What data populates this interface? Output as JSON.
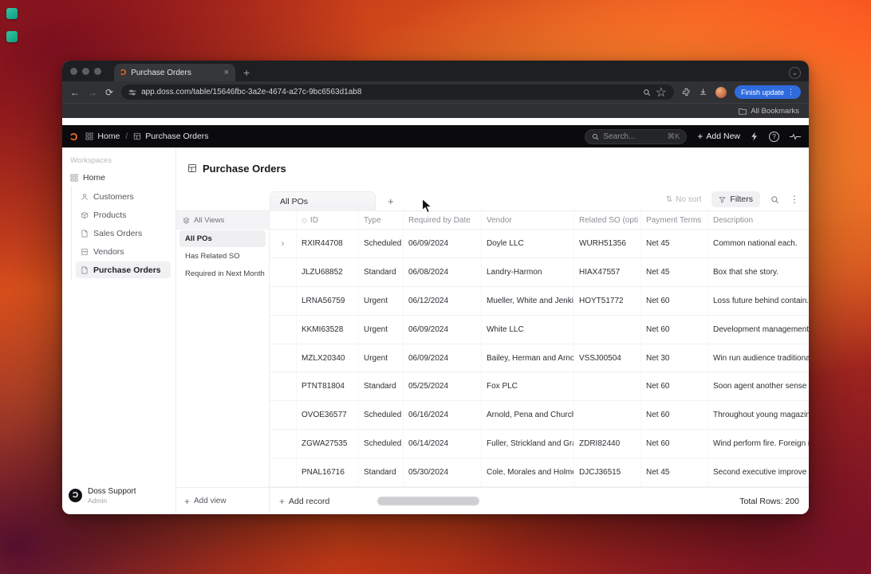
{
  "colors": {
    "accent_blue": "#2f6bdf",
    "logo_orange": "#ff6a1f",
    "header_black": "#0b0b0d"
  },
  "browser": {
    "tab_title": "Purchase Orders",
    "url": "app.doss.com/table/15646fbc-3a2e-4674-a27c-9bc6563d1ab8",
    "update_button": "Finish update",
    "bookmarks_label": "All Bookmarks"
  },
  "app": {
    "header": {
      "breadcrumb_home": "Home",
      "breadcrumb_separator": "/",
      "breadcrumb_current": "Purchase Orders",
      "search_placeholder": "Search...",
      "search_shortcut": "⌘K",
      "add_new_label": "Add New"
    },
    "sidebar": {
      "workspaces_label": "Workspaces",
      "home_label": "Home",
      "items": [
        {
          "label": "Customers"
        },
        {
          "label": "Products"
        },
        {
          "label": "Sales Orders"
        },
        {
          "label": "Vendors"
        },
        {
          "label": "Purchase Orders"
        }
      ],
      "selected_item": "Purchase Orders",
      "user_name": "Doss Support",
      "user_role": "Admin"
    },
    "main": {
      "page_title": "Purchase Orders",
      "view_tab": "All POs",
      "toolbar": {
        "no_sort_label": "No sort",
        "filters_label": "Filters"
      },
      "views_panel": {
        "header": "All Views",
        "items": [
          "All POs",
          "Has Related SO",
          "Required in Next Month"
        ],
        "selected": "All POs",
        "add_view_label": "Add view"
      },
      "table": {
        "columns": {
          "id": "ID",
          "type": "Type",
          "date": "Required by Date",
          "vendor": "Vendor",
          "related_so": "Related SO (opti",
          "payment_terms": "Payment Terms",
          "description": "Description"
        },
        "rows": [
          {
            "id": "RXIR44708",
            "type": "Scheduled",
            "date": "06/09/2024",
            "vendor": "Doyle LLC",
            "related_so": "WURH51356",
            "payment_terms": "Net 45",
            "description": "Common national each."
          },
          {
            "id": "JLZU68852",
            "type": "Standard",
            "date": "06/08/2024",
            "vendor": "Landry-Harmon",
            "related_so": "HIAX47557",
            "payment_terms": "Net 45",
            "description": "Box that she story."
          },
          {
            "id": "LRNA56759",
            "type": "Urgent",
            "date": "06/12/2024",
            "vendor": "Mueller, White and Jenkins",
            "related_so": "HOYT51772",
            "payment_terms": "Net 60",
            "description": "Loss future behind contain."
          },
          {
            "id": "KKMI63528",
            "type": "Urgent",
            "date": "06/09/2024",
            "vendor": "White LLC",
            "related_so": "",
            "payment_terms": "Net 60",
            "description": "Development management grou"
          },
          {
            "id": "MZLX20340",
            "type": "Urgent",
            "date": "06/09/2024",
            "vendor": "Bailey, Herman and Arnold",
            "related_so": "VSSJ00504",
            "payment_terms": "Net 30",
            "description": "Win run audience traditional. Pag"
          },
          {
            "id": "PTNT81804",
            "type": "Standard",
            "date": "05/25/2024",
            "vendor": "Fox PLC",
            "related_so": "",
            "payment_terms": "Net 60",
            "description": "Soon agent another sense hot."
          },
          {
            "id": "OVOE36577",
            "type": "Scheduled",
            "date": "06/16/2024",
            "vendor": "Arnold, Pena and Church",
            "related_so": "",
            "payment_terms": "Net 60",
            "description": "Throughout young magazine tea"
          },
          {
            "id": "ZGWA27535",
            "type": "Scheduled",
            "date": "06/14/2024",
            "vendor": "Fuller, Strickland and Gray",
            "related_so": "ZDRI82440",
            "payment_terms": "Net 60",
            "description": "Wind perform fire. Foreign rest e"
          },
          {
            "id": "PNAL16716",
            "type": "Standard",
            "date": "05/30/2024",
            "vendor": "Cole, Morales and Holmes",
            "related_so": "DJCJ36515",
            "payment_terms": "Net 45",
            "description": "Second executive improve finally"
          }
        ],
        "add_record_label": "Add record",
        "total_rows_label": "Total Rows: 200"
      }
    }
  },
  "icons": {
    "logo": "Ɔ",
    "back": "←",
    "forward": "→",
    "reload": "⟳",
    "star": "☆",
    "kebab": "⋮",
    "plus": "+",
    "close": "×",
    "chevron_down": "⌄",
    "diamond": "◇",
    "row_chevron": "›",
    "sort": "⇅",
    "help": "?"
  }
}
